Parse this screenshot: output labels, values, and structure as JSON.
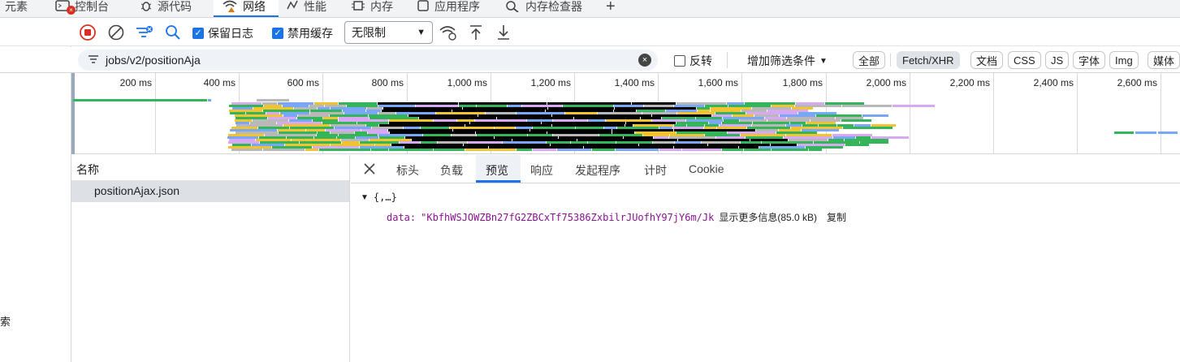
{
  "top_tabs": [
    {
      "label": "元素"
    },
    {
      "label": "控制台"
    },
    {
      "label": "源代码"
    },
    {
      "label": "网络"
    },
    {
      "label": "性能"
    },
    {
      "label": "内存"
    },
    {
      "label": "应用程序"
    },
    {
      "label": "内存检查器"
    }
  ],
  "toolbar": {
    "preserve_log": "保留日志",
    "disable_cache": "禁用缓存",
    "throttle_value": "无限制"
  },
  "filter": {
    "value": "jobs/v2/positionAja",
    "invert_label": "反转",
    "more_filters": "增加筛选条件",
    "types": [
      "全部",
      "Fetch/XHR",
      "文档",
      "CSS",
      "JS",
      "字体",
      "Img",
      "媒体"
    ],
    "active_type": "Fetch/XHR"
  },
  "overview": {
    "ticks": [
      "200 ms",
      "400 ms",
      "600 ms",
      "800 ms",
      "1,000 ms",
      "1,200 ms",
      "1,400 ms",
      "1,600 ms",
      "1,800 ms",
      "2,000 ms",
      "2,200 ms",
      "2,400 ms",
      "2,600 ms"
    ]
  },
  "requests": {
    "header": "名称",
    "rows": [
      "positionAjax.json"
    ]
  },
  "detail": {
    "tabs": [
      "标头",
      "负载",
      "预览",
      "响应",
      "发起程序",
      "计时",
      "Cookie"
    ],
    "active_tab": "预览",
    "preview": {
      "root": "{,…}",
      "key": "data:",
      "value": "\"KbfhWSJOWZBn27fG2ZBCxTf75386ZxbilrJUofhY97jY6m/Jk",
      "show_more": "显示更多信息(85.0 kB)",
      "copy": "复制"
    }
  },
  "left_stub": {
    "partial_text": "索"
  },
  "colors": {
    "accent": "#1a73e8",
    "record_red": "#d93025",
    "string_purple": "#881391"
  }
}
